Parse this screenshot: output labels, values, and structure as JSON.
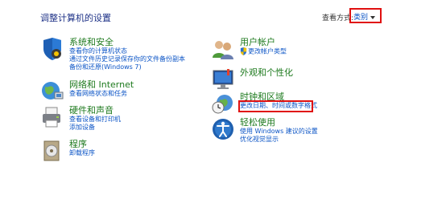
{
  "header": {
    "title": "调整计算机的设置",
    "view_by_label": "查看方式:",
    "view_by_value": "类别"
  },
  "left_column": [
    {
      "title": "系统和安全",
      "links": [
        "查看你的计算机状态",
        "通过文件历史记录保存你的文件备份副本",
        "备份和还原(Windows 7)"
      ]
    },
    {
      "title": "网络和 Internet",
      "links": [
        "查看网络状态和任务"
      ]
    },
    {
      "title": "硬件和声音",
      "links": [
        "查看设备和打印机",
        "添加设备"
      ]
    },
    {
      "title": "程序",
      "links": [
        "卸载程序"
      ]
    }
  ],
  "right_column": [
    {
      "title": "用户帐户",
      "links": [
        "更改帐户类型"
      ]
    },
    {
      "title": "外观和个性化",
      "links": []
    },
    {
      "title": "时钟和区域",
      "links": [
        "更改日期、时间或数字格式"
      ]
    },
    {
      "title": "轻松使用",
      "links": [
        "使用 Windows 建议的设置",
        "优化视觉显示"
      ]
    }
  ],
  "colors": {
    "title_blue": "#1e3287",
    "category_green": "#1e7a1e",
    "link_blue": "#0b54c6",
    "highlight_red": "#e01010"
  }
}
